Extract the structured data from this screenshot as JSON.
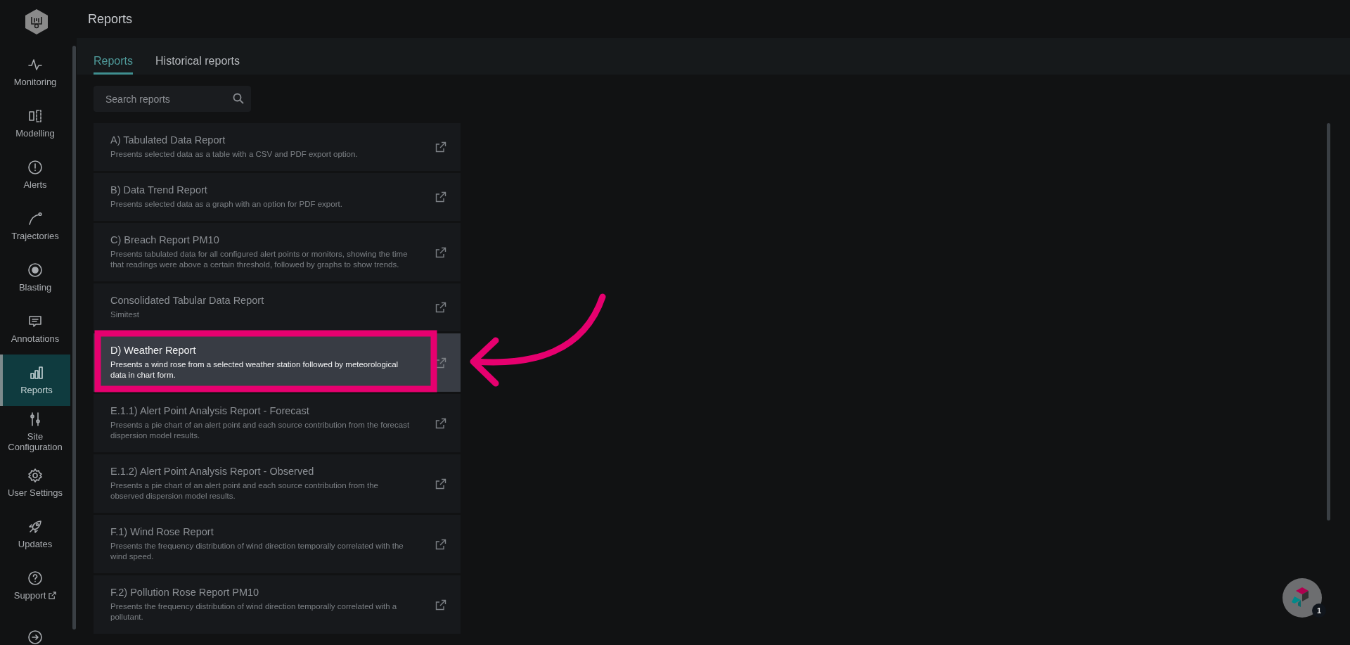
{
  "sidebar": {
    "items": [
      {
        "kind": "monitoring",
        "label": "Monitoring",
        "selected": false,
        "external": false
      },
      {
        "kind": "modelling",
        "label": "Modelling",
        "selected": false,
        "external": false
      },
      {
        "kind": "alerts",
        "label": "Alerts",
        "selected": false,
        "external": false
      },
      {
        "kind": "trajectories",
        "label": "Trajectories",
        "selected": false,
        "external": false
      },
      {
        "kind": "blasting",
        "label": "Blasting",
        "selected": false,
        "external": false
      },
      {
        "kind": "annotations",
        "label": "Annotations",
        "selected": false,
        "external": false
      },
      {
        "kind": "reports",
        "label": "Reports",
        "selected": true,
        "external": false
      },
      {
        "kind": "site",
        "label": "Site Configuration",
        "selected": false,
        "external": false
      },
      {
        "kind": "settings",
        "label": "User Settings",
        "selected": false,
        "external": false
      },
      {
        "kind": "updates",
        "label": "Updates",
        "selected": false,
        "external": false
      },
      {
        "kind": "support",
        "label": "Support",
        "selected": false,
        "external": true
      },
      {
        "kind": "logout",
        "selected": false
      }
    ]
  },
  "page": {
    "title": "Reports"
  },
  "tabs": [
    {
      "label": "Reports",
      "selected": true
    },
    {
      "label": "Historical reports",
      "selected": false
    }
  ],
  "search": {
    "placeholder": "Search reports"
  },
  "reports": [
    {
      "title": "A) Tabulated Data Report",
      "description": "Presents selected data as a table with a CSV and PDF export option.",
      "selected": false
    },
    {
      "title": "B) Data Trend Report",
      "description": "Presents selected data as a graph with an option for PDF export.",
      "selected": false
    },
    {
      "title": "C) Breach Report PM10",
      "description": "Presents tabulated data for all configured alert points or monitors, showing the time that readings were above a certain threshold, followed by graphs to show trends.",
      "selected": false
    },
    {
      "title": "Consolidated Tabular Data Report",
      "description": "Simitest",
      "selected": false
    },
    {
      "title": "D) Weather Report",
      "description": "Presents a wind rose from a selected weather station followed by meteorological data in chart form.",
      "selected": true
    },
    {
      "title": "E.1.1) Alert Point Analysis Report - Forecast",
      "description": "Presents a pie chart of an alert point and each source contribution from the forecast dispersion model results.",
      "selected": false
    },
    {
      "title": "E.1.2) Alert Point Analysis Report - Observed",
      "description": "Presents a pie chart of an alert point and each source contribution from the observed dispersion model results.",
      "selected": false
    },
    {
      "title": "F.1) Wind Rose Report",
      "description": "Presents the frequency distribution of wind direction temporally correlated with the wind speed.",
      "selected": false
    },
    {
      "title": "F.2) Pollution Rose Report PM10",
      "description": "Presents the frequency distribution of wind direction temporally correlated with a pollutant.",
      "selected": false
    }
  ],
  "help_widget": {
    "badge": "1"
  }
}
